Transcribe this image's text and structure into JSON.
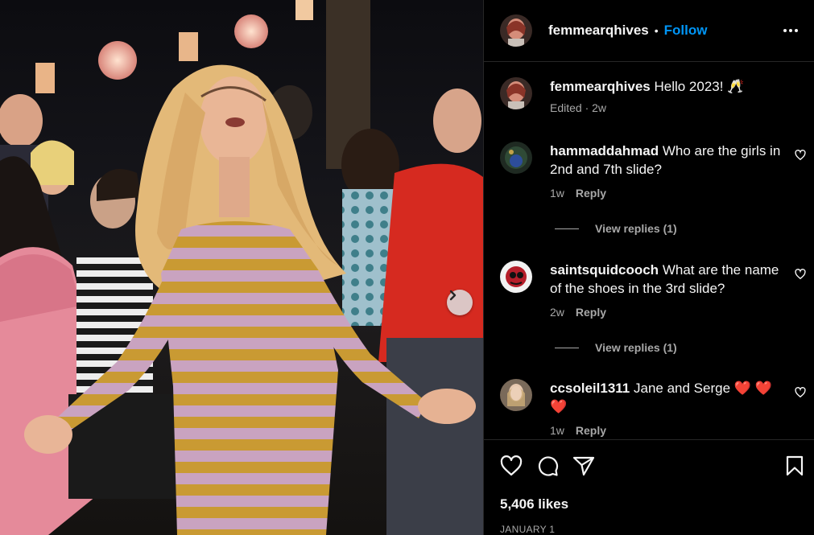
{
  "post": {
    "author": "femmearqhives",
    "follow_label": "Follow",
    "separator": "•"
  },
  "caption": {
    "username": "femmearqhives",
    "text": "Hello 2023! 🥂",
    "meta": "Edited · 2w"
  },
  "comments": [
    {
      "username": "hammaddahmad",
      "text": "Who are the girls in 2nd and 7th slide?",
      "age": "1w",
      "reply_label": "Reply",
      "view_replies": "View replies (1)"
    },
    {
      "username": "saintsquidcooch",
      "text": "What are the name of the shoes in the 3rd slide?",
      "age": "2w",
      "reply_label": "Reply",
      "view_replies": "View replies (1)"
    },
    {
      "username": "ccsoleil1311",
      "text": "Jane and Serge ❤️ ❤️ ❤️",
      "age": "1w",
      "reply_label": "Reply"
    }
  ],
  "footer": {
    "likes": "5,406 likes",
    "date": "JANUARY 1"
  },
  "colors": {
    "accent": "#0095f6",
    "background": "#000000",
    "secondary_text": "#a8a8a8",
    "divider": "#262626"
  },
  "icons": {
    "like": "heart-icon",
    "comment": "comment-icon",
    "share": "paper-plane-icon",
    "save": "bookmark-icon",
    "more": "more-options-icon",
    "next": "chevron-right-icon"
  }
}
